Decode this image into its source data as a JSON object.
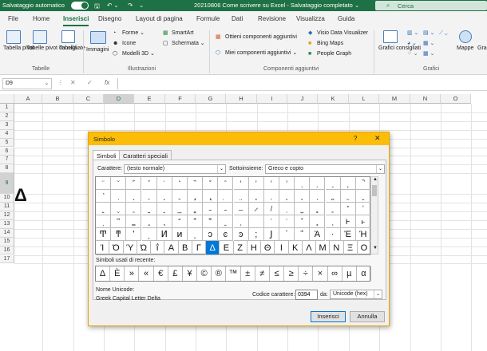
{
  "titlebar": {
    "autosave": "Salvataggio automatico",
    "title": "20210806 Come scrivere su Excel  -  Salvataggio completato ⌄",
    "search": "Cerca"
  },
  "tabs": [
    "File",
    "Home",
    "Inserisci",
    "Disegno",
    "Layout di pagina",
    "Formule",
    "Dati",
    "Revisione",
    "Visualizza",
    "Guida"
  ],
  "ribbon": {
    "tabella_pivot": "Tabella pivot",
    "tabelle_pivot_consigliate": "Tabelle pivot consigliate",
    "tabella": "Tabella",
    "immagini": "Immagini",
    "forme": "Forme ⌄",
    "icone": "Icone",
    "modelli3d": "Modelli 3D  ⌄",
    "smartart": "SmartArt",
    "schermata": "Schermata ⌄",
    "ottieni": "Ottieni componenti aggiuntivi",
    "miei": "Miei componenti aggiuntivi  ⌄",
    "visio": "Visio Data Visualizer",
    "bing": "Bing Maps",
    "people": "People Graph",
    "grafici_consigliati": "Grafici consigliati",
    "mappe": "Mappe",
    "gra": "Gra piv",
    "grp_tabelle": "Tabelle",
    "grp_illustrazioni": "Illustrazioni",
    "grp_componenti": "Componenti aggiuntivi",
    "grp_grafici": "Grafici"
  },
  "formula_bar": {
    "name": "D9",
    "fx": "fx"
  },
  "columns": [
    "A",
    "B",
    "C",
    "D",
    "E",
    "F",
    "G",
    "H",
    "I",
    "J",
    "K",
    "L",
    "M",
    "N",
    "O"
  ],
  "rows": [
    "1",
    "2",
    "3",
    "4",
    "5",
    "6",
    "7",
    "8",
    "9",
    "10",
    "11",
    "12",
    "13",
    "14",
    "15",
    "16",
    "17"
  ],
  "cell_d9": "Δ",
  "dialog": {
    "title": "Simbolo",
    "help": "?",
    "close": "✕",
    "tab_symbols": "Simboli",
    "tab_special": "Caratteri speciali",
    "font_label": "Carattere:",
    "font_value": "(testo normale)",
    "subset_label": "Sottoinsieme:",
    "subset_value": "Greco e copto",
    "grid": [
      [
        "̈",
        "̆",
        "̋",
        "̌",
        "̍",
        "̎",
        "̏",
        "̐",
        "̑",
        "̒",
        "̓",
        "̔",
        "̕",
        "̖",
        "̗",
        "̘",
        "̙",
        "̚"
      ],
      [
        "̛",
        "̜",
        "̝",
        "̞",
        "̟",
        "̠",
        "̡",
        "̢",
        "̣",
        "̤",
        "̥",
        "̦",
        "̧",
        "̨",
        "̩",
        "̪",
        "̫",
        "̬"
      ],
      [
        "̭",
        "̮",
        "̯",
        "̰",
        "̱",
        "̲",
        "̳",
        "̴",
        "̵",
        "̶",
        "̷",
        "̸",
        "̹",
        "̺",
        "̻",
        "̼",
        "̽",
        "̾"
      ],
      [
        "ͅ",
        "͆",
        "͇",
        "͈",
        "͉",
        "͊",
        "͋",
        "͌",
        "͍",
        "͎",
        "͏",
        "͐",
        "͑",
        "͒",
        "͓",
        "͔",
        "Ͱ",
        "ͱ"
      ],
      [
        "Ͳ",
        "ͳ",
        "ʹ",
        "͵",
        "Ͷ",
        "ͷ",
        "ͺ",
        "ͻ",
        "ͼ",
        "ͽ",
        ";",
        "Ϳ",
        "΄",
        "΅",
        "Ά",
        "·",
        "Έ",
        "Ή"
      ],
      [
        "Ί",
        "Ό",
        "Ύ",
        "Ώ",
        "ΐ",
        "Α",
        "Β",
        "Γ",
        "Δ",
        "Ε",
        "Ζ",
        "Η",
        "Θ",
        "Ι",
        "Κ",
        "Λ",
        "Μ",
        "Ν",
        "Ξ",
        "Ο"
      ]
    ],
    "recent_label": "Simboli usati di recente:",
    "recent": [
      "Δ",
      "È",
      "»",
      "«",
      "€",
      "£",
      "¥",
      "©",
      "®",
      "™",
      "±",
      "≠",
      "≤",
      "≥",
      "÷",
      "×",
      "∞",
      "µ",
      "α"
    ],
    "unicode_name_label": "Nome Unicode:",
    "unicode_name": "Greek Capital Letter Delta",
    "code_label": "Codice carattere:",
    "code_value": "0394",
    "from_label": "da:",
    "from_value": "Unicode (hex)",
    "insert": "Inserisci",
    "cancel": "Annulla"
  },
  "colors": {
    "excel_green": "#1e7145",
    "dialog_title": "#fbbd08",
    "highlight": "#0078d7"
  }
}
